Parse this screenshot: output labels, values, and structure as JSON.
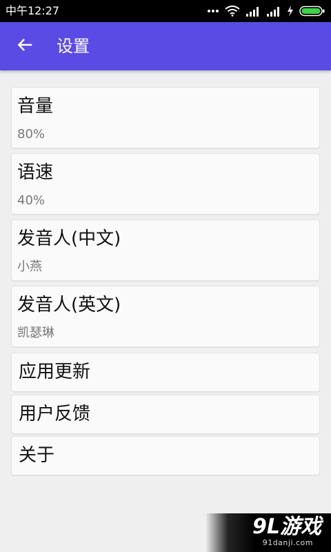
{
  "status_bar": {
    "time": "中午12:27",
    "icons": [
      "more-dots-icon",
      "wifi-icon",
      "signal-icon",
      "signal-icon",
      "charging-icon",
      "battery-icon"
    ]
  },
  "app_bar": {
    "back_icon": "arrow-left-icon",
    "title": "设置",
    "color": "#5a4be4"
  },
  "settings": [
    {
      "title": "音量",
      "value": "80%"
    },
    {
      "title": "语速",
      "value": "40%"
    },
    {
      "title": "发音人(中文)",
      "value": "小燕"
    },
    {
      "title": "发音人(英文)",
      "value": "凯瑟琳"
    },
    {
      "title": "应用更新"
    },
    {
      "title": "用户反馈"
    },
    {
      "title": "关于"
    }
  ],
  "watermark": {
    "logo": "9L游戏",
    "url": "91danji.com"
  }
}
